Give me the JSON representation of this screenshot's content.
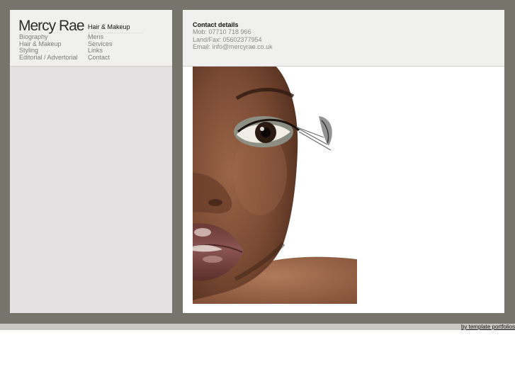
{
  "site": {
    "brand": "Mercy Rae"
  },
  "nav": {
    "section_title": "Hair & Makeup",
    "main_items": [
      {
        "label": "Biography"
      },
      {
        "label": "Hair & Makeup"
      },
      {
        "label": "Styling"
      },
      {
        "label": "Editorial / Advertorial"
      }
    ],
    "sub_items": [
      {
        "label": "Mens"
      },
      {
        "label": "Services"
      },
      {
        "label": "Links"
      },
      {
        "label": "Contact"
      }
    ]
  },
  "contact": {
    "title": "Contact details",
    "mobile": "Mob: 07710 718 966",
    "landfax": "Land/Fax: 05602377954",
    "email": "Email: info@mercyrae.co.uk"
  },
  "footer": {
    "credit": "by template portfolios"
  },
  "colors": {
    "frame": "#77746c",
    "panel_header": "#f0f0ef",
    "left_panel": "#e3e1e1",
    "footer_bar": "#c9c8c2"
  }
}
